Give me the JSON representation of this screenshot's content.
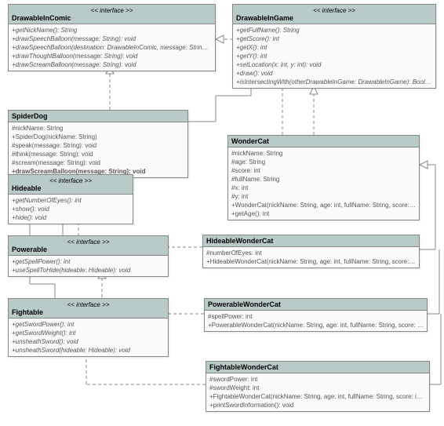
{
  "diagram": {
    "stereotype_label": "<< interface >>",
    "classes": {
      "drawableInComic": {
        "name": "DrawableInComic",
        "members": [
          "+getNickName(): String",
          "+drawSpeechBalloon(message: String): void",
          "+drawSpeechBalloon(destination: DrawableInComic, message: String): void",
          "+drawThoughtBalloon(message: String): void",
          "+drawScreamBalloon(message: String): void"
        ]
      },
      "drawableInGame": {
        "name": "DrawableInGame",
        "members": [
          "+getFullName(): String",
          "+getScore(): int",
          "+getX(): int",
          "+getY(): int",
          "+setLocation(x: int, y: int): void",
          "+draw(): void",
          "+isIntersectingWith(otherDrawableInGame: DrawableInGame): Boolean"
        ]
      },
      "spiderDog": {
        "name": "SpiderDog",
        "attrs": [
          "#nickName: String",
          "+SpiderDog(nickName: String)",
          "#speak(message: String): void",
          "#think(message: String): void",
          "#scream(message: String): void",
          "+drawScreamBalloon(message: String): void"
        ]
      },
      "wonderCat": {
        "name": "WonderCat",
        "attrs": [
          "#nickName: String",
          "#age: String",
          "#score: int",
          "#fullName: String",
          "#x: int",
          "#y: int",
          "+WonderCat(nickName: String, age: int, fullName: String, score: int, x: int, y: int)",
          "+getAge(): int"
        ]
      },
      "hideable": {
        "name": "Hideable",
        "members": [
          "+getNumberOfEyes(): int",
          "+show(): void",
          "+hide(): void"
        ]
      },
      "powerable": {
        "name": "Powerable",
        "members": [
          "+getSpellPower(): int",
          "+useSpellToHide(hideable: Hideable): void"
        ]
      },
      "fightable": {
        "name": "Fightable",
        "members": [
          "+getSwordPower(): int",
          "+getSwordWeight(): int",
          "+unsheathSword(): void",
          "+unsheathSword(hideable: Hideable): void"
        ]
      },
      "hideableWonderCat": {
        "name": "HideableWonderCat",
        "attrs": [
          "#numberOfEyes: int",
          "+HideableWonderCat(nickName: String, age: int, fullName: String, score: int, x: int, y: int, numberOfEyes: int)"
        ]
      },
      "powerableWonderCat": {
        "name": "PowerableWonderCat",
        "attrs": [
          "#spellPower: int",
          "+PowerableWonderCat(nickName: String, age: int, fullName: String, score: int, x: int, y: int, spellPower: int)"
        ]
      },
      "fightableWonderCat": {
        "name": "FightableWonderCat",
        "attrs": [
          "#swordPower: int",
          "#swordWeight: int",
          "+FightableWonderCat(nickName: String, age: int, fullName: String, score: int, x: int, y: int, swordPower: int, swordWeight: int)",
          "+printSwordInformation(): void"
        ]
      }
    }
  }
}
